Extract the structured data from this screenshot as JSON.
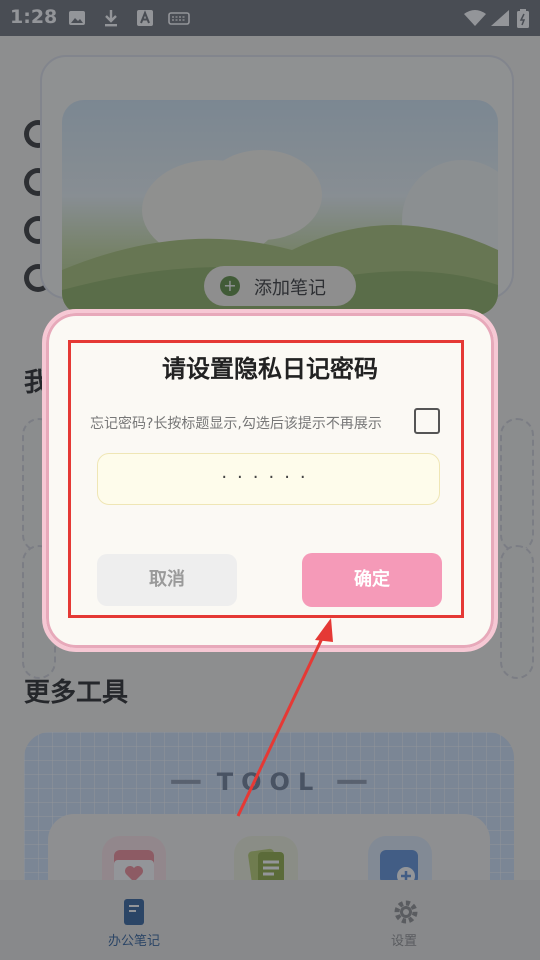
{
  "status_bar": {
    "time": "1:28",
    "left_icons": [
      "image-icon",
      "download-icon",
      "font-icon",
      "keyboard-icon"
    ],
    "right_icons": [
      "wifi-icon",
      "signal-icon",
      "battery-icon"
    ]
  },
  "background": {
    "add_note_label": "添加笔记",
    "section_title_partial": "我",
    "more_tools_title": "更多工具",
    "tool_banner": "TOOL",
    "tools": [
      "calendar-heart-icon",
      "notes-icon",
      "photo-add-icon"
    ]
  },
  "bottom_nav": {
    "items": [
      {
        "label": "办公笔记",
        "icon": "notebook-icon",
        "active": true
      },
      {
        "label": "设置",
        "icon": "gear-icon",
        "active": false
      }
    ]
  },
  "dialog": {
    "title": "请设置隐私日记密码",
    "hint": "忘记密码?长按标题显示,勾选后该提示不再展示",
    "password_mask": "······",
    "cancel_label": "取消",
    "confirm_label": "确定"
  },
  "colors": {
    "accent_pink": "#f59ab8",
    "annotation_red": "#e53935",
    "overlay": "rgba(40,44,52,0.5)"
  }
}
